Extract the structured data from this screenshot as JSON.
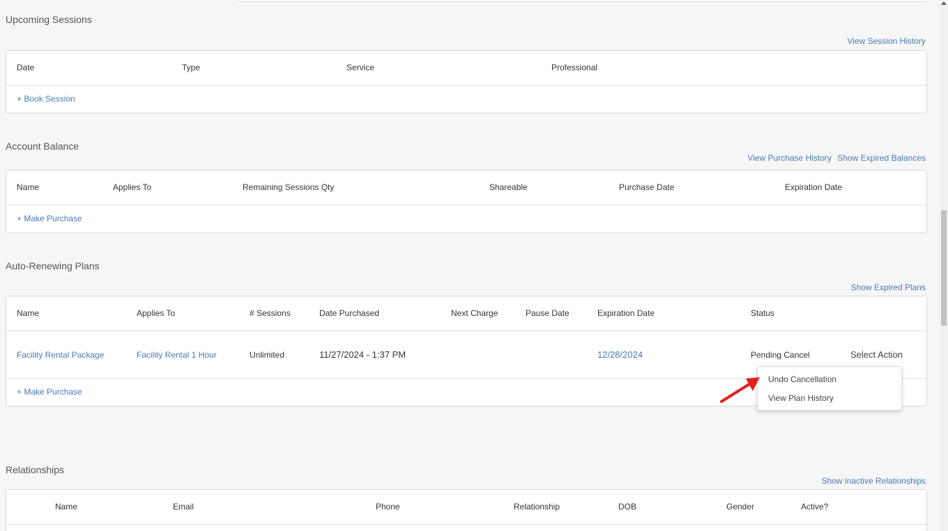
{
  "upcoming": {
    "title": "Upcoming Sessions",
    "links": [
      "View Session History"
    ],
    "headers": [
      "Date",
      "Type",
      "Service",
      "Professional"
    ],
    "add_label": "+ Book Session"
  },
  "balance": {
    "title": "Account Balance",
    "links": [
      "View Purchase History",
      "Show Expired Balances"
    ],
    "headers": [
      "Name",
      "Applies To",
      "Remaining Sessions Qty",
      "Shareable",
      "Purchase Date",
      "Expiration Date"
    ],
    "add_label": "+ Make Purchase"
  },
  "plans": {
    "title": "Auto-Renewing Plans",
    "links": [
      "Show Expired Plans"
    ],
    "headers": [
      "Name",
      "Applies To",
      "# Sessions",
      "Date Purchased",
      "Next Charge",
      "Pause Date",
      "Expiration Date",
      "Status"
    ],
    "rows": [
      {
        "name": "Facility Rental Package",
        "applies_to": "Facility Rental 1 Hour",
        "sessions": "Unlimited",
        "date_purchased": "11/27/2024 - 1:37 PM",
        "next_charge": "",
        "pause_date": "",
        "expiration_date": "12/28/2024",
        "status": "Pending Cancel",
        "action_label": "Select Action"
      }
    ],
    "add_label": "+ Make Purchase",
    "action_menu": [
      "Undo Cancellation",
      "View Plan History"
    ]
  },
  "relationships": {
    "title": "Relationships",
    "links": [
      "Show inactive Relationships"
    ],
    "headers": [
      "Name",
      "Email",
      "Phone",
      "Relationship",
      "DOB",
      "Gender",
      "Active?"
    ]
  },
  "colors": {
    "link": "#4a79b8",
    "annotation_arrow": "#e02020"
  }
}
